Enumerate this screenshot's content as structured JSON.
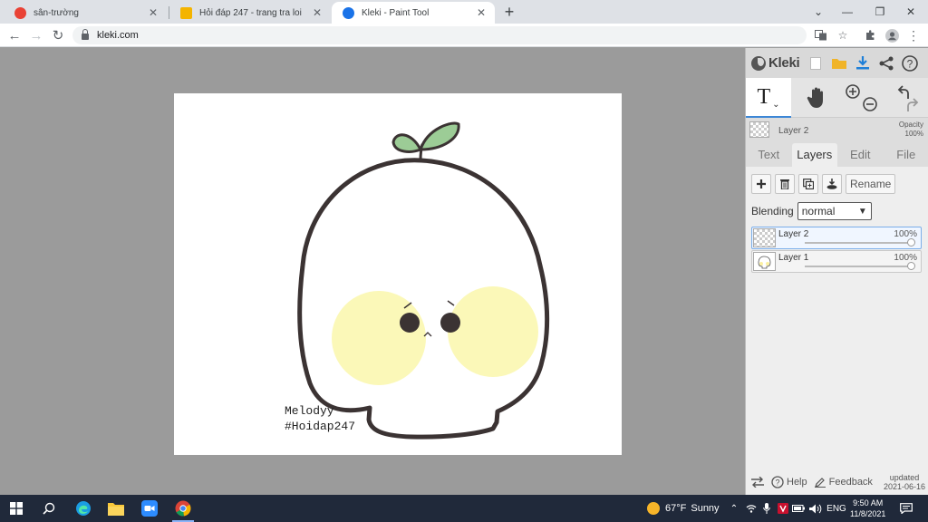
{
  "browser": {
    "tabs": [
      {
        "title": "sân-trường",
        "icon": "c-icon",
        "color": "#e94235"
      },
      {
        "title": "Hỏi đáp 247 - trang tra loi",
        "icon": "h-icon",
        "color": "#f4b400"
      },
      {
        "title": "Kleki - Paint Tool",
        "icon": "kleki-icon",
        "color": "#1a73e8"
      }
    ],
    "url": "kleki.com"
  },
  "canvas": {
    "signature_line1": "Melodyy",
    "signature_line2": "#Hoidap247"
  },
  "kleki": {
    "logo": "Kleki",
    "current_layer": "Layer 2",
    "opacity_label": "Opacity",
    "opacity_value": "100%",
    "panel_tabs": [
      "Text",
      "Layers",
      "Edit",
      "File"
    ],
    "active_tab": "Layers",
    "rename_label": "Rename",
    "blending_label": "Blending",
    "blending_value": "normal",
    "layers": [
      {
        "name": "Layer 2",
        "opacity": "100%",
        "opacity_value": 1.0,
        "active": true
      },
      {
        "name": "Layer 1",
        "opacity": "100%",
        "opacity_value": 1.0,
        "active": false
      }
    ],
    "footer": {
      "help": "Help",
      "feedback": "Feedback",
      "updated_label": "updated",
      "updated_date": "2021-06-16"
    }
  },
  "taskbar": {
    "temperature": "67°F",
    "weather": "Sunny",
    "language": "ENG",
    "time": "9:50 AM",
    "date": "11/8/2021"
  },
  "colors": {
    "accent": "#3c87d6",
    "outline": "#3b3333",
    "cheek": "#fbf7b0",
    "leaf": "#9ccc96",
    "taskbar": "#20293a"
  }
}
